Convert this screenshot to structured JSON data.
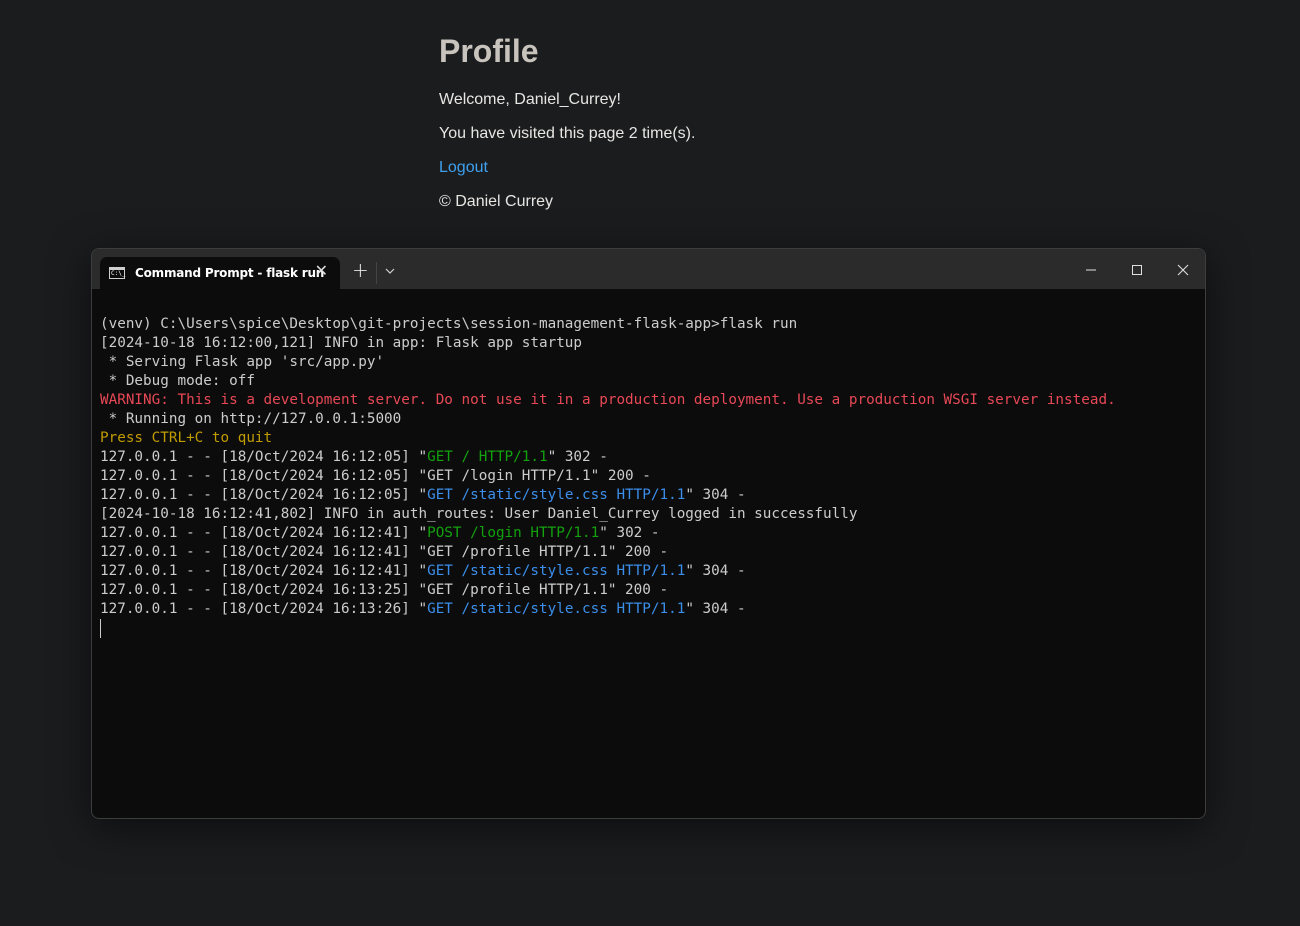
{
  "page": {
    "title": "Profile",
    "welcome": "Welcome, Daniel_Currey!",
    "visits": "You have visited this page 2 time(s).",
    "logout_label": "Logout",
    "footer": "© Daniel Currey",
    "link_color": "#3fa1ee"
  },
  "terminal": {
    "tab_icon": "command-prompt-icon",
    "tab_icon_text": "C:\\_",
    "tab_title": "Command Prompt - flask  run",
    "tab_close": "✕",
    "new_tab": "+",
    "lines": [
      {
        "segments": [
          {
            "text": "(venv) C:\\Users\\spice\\Desktop\\git-projects\\session-management-flask-app>flask run",
            "color": "default"
          }
        ]
      },
      {
        "segments": [
          {
            "text": "[2024-10-18 16:12:00,121] INFO in app: Flask app startup",
            "color": "default"
          }
        ]
      },
      {
        "segments": [
          {
            "text": " * Serving Flask app 'src/app.py'",
            "color": "default"
          }
        ]
      },
      {
        "segments": [
          {
            "text": " * Debug mode: off",
            "color": "default"
          }
        ]
      },
      {
        "segments": [
          {
            "text": "WARNING: This is a development server. Do not use it in a production deployment. Use a production WSGI server instead.",
            "color": "red"
          }
        ]
      },
      {
        "segments": [
          {
            "text": " * Running on http://127.0.0.1:5000",
            "color": "default"
          }
        ]
      },
      {
        "segments": [
          {
            "text": "Press CTRL+C to quit",
            "color": "yellow"
          }
        ]
      },
      {
        "segments": [
          {
            "text": "127.0.0.1 - - [18/Oct/2024 16:12:05] \"",
            "color": "default"
          },
          {
            "text": "GET / HTTP/1.1",
            "color": "green"
          },
          {
            "text": "\" 302 -",
            "color": "default"
          }
        ]
      },
      {
        "segments": [
          {
            "text": "127.0.0.1 - - [18/Oct/2024 16:12:05] \"GET /login HTTP/1.1\" 200 -",
            "color": "default"
          }
        ]
      },
      {
        "segments": [
          {
            "text": "127.0.0.1 - - [18/Oct/2024 16:12:05] \"",
            "color": "default"
          },
          {
            "text": "GET /static/style.css HTTP/1.1",
            "color": "blue"
          },
          {
            "text": "\" 304 -",
            "color": "default"
          }
        ]
      },
      {
        "segments": [
          {
            "text": "[2024-10-18 16:12:41,802] INFO in auth_routes: User Daniel_Currey logged in successfully",
            "color": "default"
          }
        ]
      },
      {
        "segments": [
          {
            "text": "127.0.0.1 - - [18/Oct/2024 16:12:41] \"",
            "color": "default"
          },
          {
            "text": "POST /login HTTP/1.1",
            "color": "green"
          },
          {
            "text": "\" 302 -",
            "color": "default"
          }
        ]
      },
      {
        "segments": [
          {
            "text": "127.0.0.1 - - [18/Oct/2024 16:12:41] \"GET /profile HTTP/1.1\" 200 -",
            "color": "default"
          }
        ]
      },
      {
        "segments": [
          {
            "text": "127.0.0.1 - - [18/Oct/2024 16:12:41] \"",
            "color": "default"
          },
          {
            "text": "GET /static/style.css HTTP/1.1",
            "color": "blue"
          },
          {
            "text": "\" 304 -",
            "color": "default"
          }
        ]
      },
      {
        "segments": [
          {
            "text": "127.0.0.1 - - [18/Oct/2024 16:13:25] \"GET /profile HTTP/1.1\" 200 -",
            "color": "default"
          }
        ]
      },
      {
        "segments": [
          {
            "text": "127.0.0.1 - - [18/Oct/2024 16:13:26] \"",
            "color": "default"
          },
          {
            "text": "GET /static/style.css HTTP/1.1",
            "color": "blue"
          },
          {
            "text": "\" 304 -",
            "color": "default"
          }
        ]
      }
    ],
    "colors": {
      "default": "#cccccc",
      "red": "#e74856",
      "yellow": "#c19c00",
      "green": "#13a10e",
      "blue": "#3b8eea",
      "background": "#0c0c0c"
    }
  }
}
